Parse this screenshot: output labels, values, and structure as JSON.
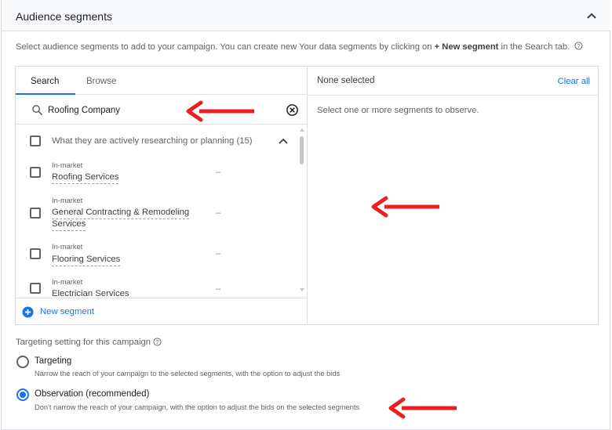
{
  "section": {
    "title": "Audience segments",
    "intro_prefix": "Select audience segments to add to your campaign. You can create new Your data segments by clicking on ",
    "intro_bold": "+ New segment",
    "intro_suffix": " in the Search tab."
  },
  "tabs": [
    {
      "label": "Search",
      "active": true
    },
    {
      "label": "Browse",
      "active": false
    }
  ],
  "search": {
    "value": "Roofing Company"
  },
  "group": {
    "label": "What they are actively researching or planning (15)"
  },
  "items": [
    {
      "category": "In-market",
      "name": "Roofing Services",
      "value": "–"
    },
    {
      "category": "In-market",
      "name_line1": "General Contracting & Remodeling",
      "name_line2": "Services",
      "value": "–"
    },
    {
      "category": "In-market",
      "name": "Flooring Services",
      "value": "–"
    },
    {
      "category": "In-market",
      "name": "Electrician Services",
      "value": "–"
    }
  ],
  "new_segment": {
    "label": "New segment"
  },
  "selected_pane": {
    "title": "None selected",
    "clear_all": "Clear all",
    "hint": "Select one or more segments to observe."
  },
  "targeting": {
    "title": "Targeting setting for this campaign",
    "options": [
      {
        "label": "Targeting",
        "description": "Narrow the reach of your campaign to the selected segments, with the option to adjust the bids",
        "checked": false
      },
      {
        "label": "Observation (recommended)",
        "description": "Don't narrow the reach of your campaign, with the option to adjust the bids on the selected segments",
        "checked": true
      }
    ]
  },
  "colors": {
    "accent": "#1a73e8",
    "annotation_arrow": "#e8201f"
  }
}
